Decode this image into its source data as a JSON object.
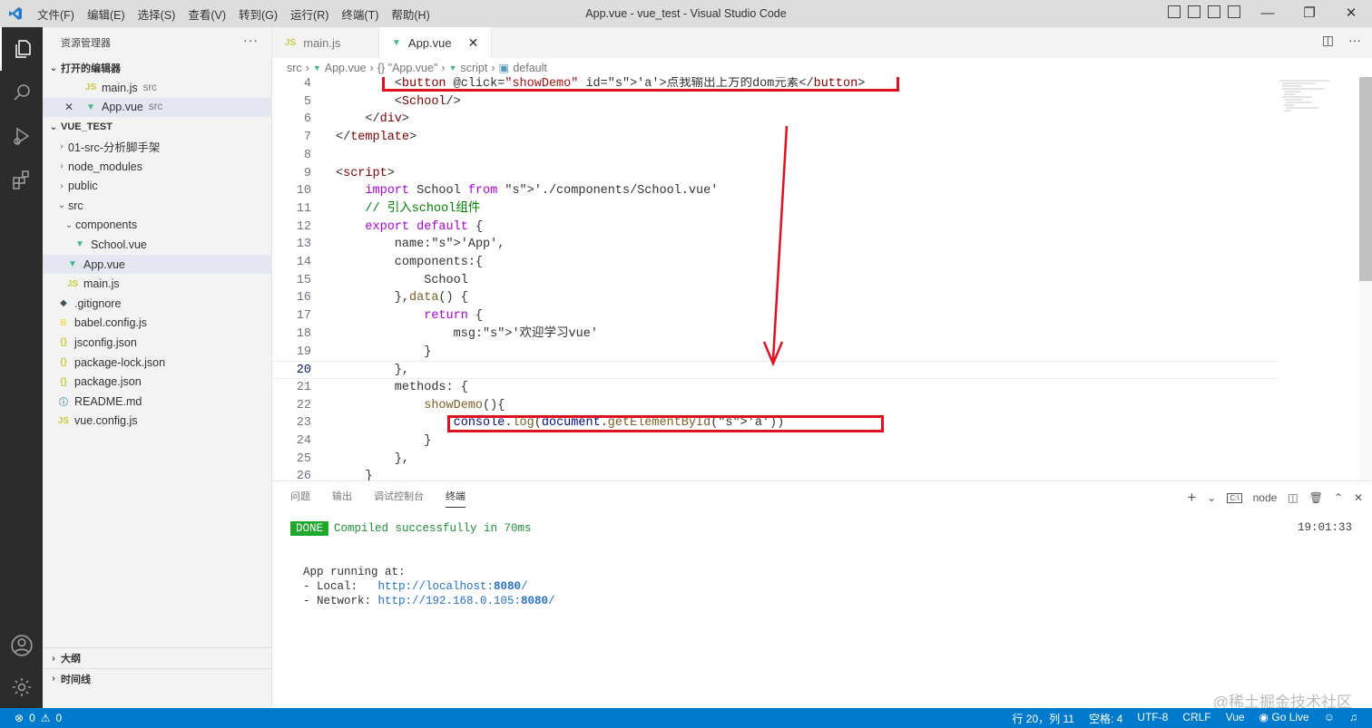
{
  "title": "App.vue - vue_test - Visual Studio Code",
  "menus": [
    "文件(F)",
    "编辑(E)",
    "选择(S)",
    "查看(V)",
    "转到(G)",
    "运行(R)",
    "终端(T)",
    "帮助(H)"
  ],
  "explorer": {
    "header": "资源管理器",
    "open_editors_label": "打开的编辑器",
    "open_editors": [
      {
        "name": "main.js",
        "dir": "src"
      },
      {
        "name": "App.vue",
        "dir": "src"
      }
    ],
    "project": "VUE_TEST",
    "tree": [
      "01-src-分析脚手架",
      "node_modules",
      "public",
      "src",
      "components",
      "School.vue",
      "App.vue",
      "main.js",
      ".gitignore",
      "babel.config.js",
      "jsconfig.json",
      "package-lock.json",
      "package.json",
      "README.md",
      "vue.config.js"
    ],
    "outline_label": "大纲",
    "timeline_label": "时间线"
  },
  "tabs": [
    {
      "label": "main.js",
      "icon": "js-icon"
    },
    {
      "label": "App.vue",
      "icon": "vue-icon"
    }
  ],
  "breadcrumb": [
    "src",
    "App.vue",
    "{} \"App.vue\"",
    "script",
    "default"
  ],
  "code_lines": [
    {
      "n": "4",
      "text": "        <button @click=\"showDemo\" id='a'>点我输出上方的dom元素</button>"
    },
    {
      "n": "5",
      "text": "        <School/>"
    },
    {
      "n": "6",
      "text": "    </div>"
    },
    {
      "n": "7",
      "text": "</template>"
    },
    {
      "n": "8",
      "text": ""
    },
    {
      "n": "9",
      "text": "<script>"
    },
    {
      "n": "10",
      "text": "    import School from './components/School.vue'"
    },
    {
      "n": "11",
      "text": "    // 引入school组件"
    },
    {
      "n": "12",
      "text": "    export default {"
    },
    {
      "n": "13",
      "text": "        name:'App',"
    },
    {
      "n": "14",
      "text": "        components:{"
    },
    {
      "n": "15",
      "text": "            School"
    },
    {
      "n": "16",
      "text": "        },data() {"
    },
    {
      "n": "17",
      "text": "            return {"
    },
    {
      "n": "18",
      "text": "                msg:'欢迎学习vue'"
    },
    {
      "n": "19",
      "text": "            }"
    },
    {
      "n": "20",
      "text": "        },"
    },
    {
      "n": "21",
      "text": "        methods: {"
    },
    {
      "n": "22",
      "text": "            showDemo(){"
    },
    {
      "n": "23",
      "text": "                console.log(document.getElementById('a'))"
    },
    {
      "n": "24",
      "text": "            }"
    },
    {
      "n": "25",
      "text": "        },"
    },
    {
      "n": "26",
      "text": "    }"
    }
  ],
  "panel": {
    "tabs": [
      "问题",
      "输出",
      "调试控制台",
      "终端"
    ],
    "active_tab": "终端",
    "terminal_name": "node",
    "done_badge": "DONE",
    "compiled": "Compiled successfully in 70ms",
    "time": "19:01:33",
    "running": "App running at:",
    "local_label": "- Local:   ",
    "local_url": "http://localhost:",
    "local_port": "8080",
    "network_label": "- Network: ",
    "network_url": "http://192.168.0.105:",
    "network_port": "8080"
  },
  "status": {
    "errors": "0",
    "warnings": "0",
    "position": "行 20，列 11",
    "spaces": "空格: 4",
    "encoding": "UTF-8",
    "eol": "CRLF",
    "language": "Vue",
    "golive": "Go Live"
  },
  "watermark": "@稀土掘金技术社区",
  "colors": {
    "statusbar": "#007acc",
    "activitybar": "#2c2c2c",
    "highlight": "#e0101e"
  }
}
